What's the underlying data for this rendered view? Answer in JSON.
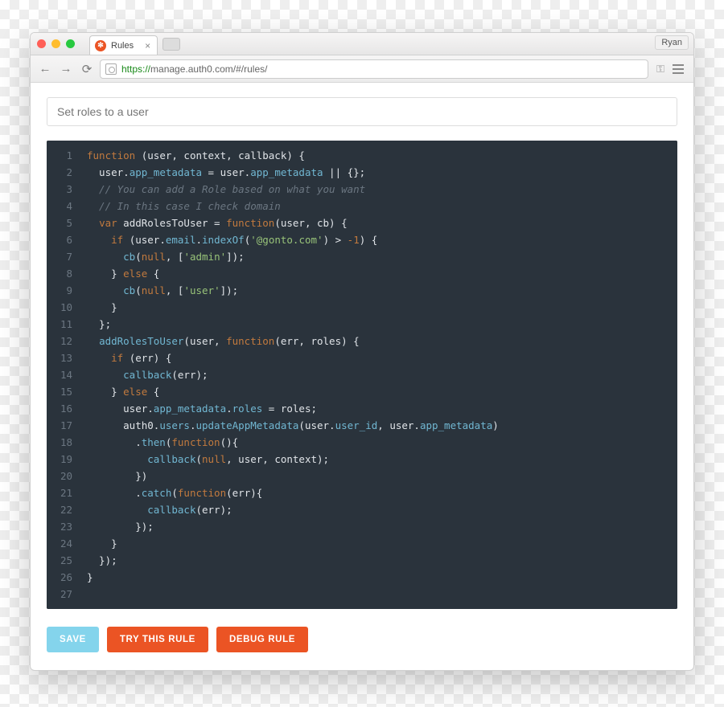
{
  "browser": {
    "tab_title": "Rules",
    "user_name": "Ryan",
    "url_protocol": "https://",
    "url_host": "manage.auth0.com",
    "url_path": "/#/rules/"
  },
  "page": {
    "rule_name_placeholder": "Set roles to a user"
  },
  "editor": {
    "line_count": 27,
    "code_tokens": [
      [
        [
          "k",
          "function"
        ],
        [
          "id",
          " (user, context, callback) {"
        ]
      ],
      [
        [
          "id",
          "  user."
        ],
        [
          "p",
          "app_metadata"
        ],
        [
          "id",
          " = user."
        ],
        [
          "p",
          "app_metadata"
        ],
        [
          "id",
          " || {};"
        ]
      ],
      [
        [
          "c",
          "  // You can add a Role based on what you want"
        ]
      ],
      [
        [
          "c",
          "  // In this case I check domain"
        ]
      ],
      [
        [
          "id",
          "  "
        ],
        [
          "k",
          "var"
        ],
        [
          "id",
          " addRolesToUser = "
        ],
        [
          "k",
          "function"
        ],
        [
          "id",
          "(user, cb) {"
        ]
      ],
      [
        [
          "id",
          "    "
        ],
        [
          "k",
          "if"
        ],
        [
          "id",
          " (user."
        ],
        [
          "p",
          "email"
        ],
        [
          "id",
          "."
        ],
        [
          "fn",
          "indexOf"
        ],
        [
          "id",
          "("
        ],
        [
          "s",
          "'@gonto.com'"
        ],
        [
          "id",
          ") > "
        ],
        [
          "n",
          "-1"
        ],
        [
          "id",
          ") {"
        ]
      ],
      [
        [
          "id",
          "      "
        ],
        [
          "fn",
          "cb"
        ],
        [
          "id",
          "("
        ],
        [
          "k",
          "null"
        ],
        [
          "id",
          ", ["
        ],
        [
          "s",
          "'admin'"
        ],
        [
          "id",
          "]);"
        ]
      ],
      [
        [
          "id",
          "    } "
        ],
        [
          "k",
          "else"
        ],
        [
          "id",
          " {"
        ]
      ],
      [
        [
          "id",
          "      "
        ],
        [
          "fn",
          "cb"
        ],
        [
          "id",
          "("
        ],
        [
          "k",
          "null"
        ],
        [
          "id",
          ", ["
        ],
        [
          "s",
          "'user'"
        ],
        [
          "id",
          "]);"
        ]
      ],
      [
        [
          "id",
          "    }"
        ]
      ],
      [
        [
          "id",
          "  };"
        ]
      ],
      [
        [
          "id",
          ""
        ]
      ],
      [
        [
          "id",
          "  "
        ],
        [
          "fn",
          "addRolesToUser"
        ],
        [
          "id",
          "(user, "
        ],
        [
          "k",
          "function"
        ],
        [
          "id",
          "(err, roles) {"
        ]
      ],
      [
        [
          "id",
          "    "
        ],
        [
          "k",
          "if"
        ],
        [
          "id",
          " (err) {"
        ]
      ],
      [
        [
          "id",
          "      "
        ],
        [
          "fn",
          "callback"
        ],
        [
          "id",
          "(err);"
        ]
      ],
      [
        [
          "id",
          "    } "
        ],
        [
          "k",
          "else"
        ],
        [
          "id",
          " {"
        ]
      ],
      [
        [
          "id",
          "      user."
        ],
        [
          "p",
          "app_metadata"
        ],
        [
          "id",
          "."
        ],
        [
          "p",
          "roles"
        ],
        [
          "id",
          " = roles;"
        ]
      ],
      [
        [
          "id",
          "      auth0."
        ],
        [
          "p",
          "users"
        ],
        [
          "id",
          "."
        ],
        [
          "fn",
          "updateAppMetadata"
        ],
        [
          "id",
          "(user."
        ],
        [
          "p",
          "user_id"
        ],
        [
          "id",
          ", user."
        ],
        [
          "p",
          "app_metadata"
        ],
        [
          "id",
          ")"
        ]
      ],
      [
        [
          "id",
          "        ."
        ],
        [
          "fn",
          "then"
        ],
        [
          "id",
          "("
        ],
        [
          "k",
          "function"
        ],
        [
          "id",
          "(){"
        ]
      ],
      [
        [
          "id",
          "          "
        ],
        [
          "fn",
          "callback"
        ],
        [
          "id",
          "("
        ],
        [
          "k",
          "null"
        ],
        [
          "id",
          ", user, context);"
        ]
      ],
      [
        [
          "id",
          "        })"
        ]
      ],
      [
        [
          "id",
          "        ."
        ],
        [
          "fn",
          "catch"
        ],
        [
          "id",
          "("
        ],
        [
          "k",
          "function"
        ],
        [
          "id",
          "(err){"
        ]
      ],
      [
        [
          "id",
          "          "
        ],
        [
          "fn",
          "callback"
        ],
        [
          "id",
          "(err);"
        ]
      ],
      [
        [
          "id",
          "        });"
        ]
      ],
      [
        [
          "id",
          "    }"
        ]
      ],
      [
        [
          "id",
          "  });"
        ]
      ],
      [
        [
          "id",
          "}"
        ]
      ]
    ]
  },
  "buttons": {
    "save": "Save",
    "try": "Try this rule",
    "debug": "Debug rule"
  }
}
